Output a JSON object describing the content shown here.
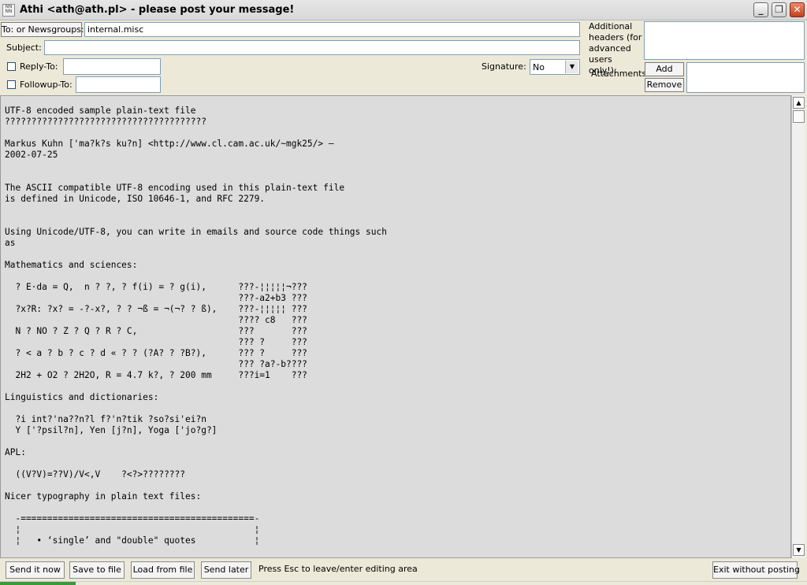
{
  "window": {
    "title": "Athi <ath@ath.pl> - please post your message!",
    "icon": "app-icon",
    "controls": [
      "minimize-icon",
      "restore-icon",
      "close-icon"
    ]
  },
  "header": {
    "to_button": "To: or Newsgroups:",
    "to_value": "internal.misc",
    "subject_label": "Subject:",
    "subject_value": "",
    "reply_to_label": "Reply-To:",
    "reply_to_value": "",
    "followup_to_label": "Followup-To:",
    "followup_to_value": "",
    "signature_label": "Signature:",
    "signature_value": "No",
    "additional_headers_label": "Additional headers (for advanced users only!):",
    "additional_headers_value": "",
    "attachments_label": "Attachments:",
    "add_button": "Add",
    "remove_button": "Remove"
  },
  "body": {
    "text": "UTF-8 encoded sample plain-text file\n??????????????????????????????????????\n\nMarkus Kuhn ['ma?k?s ku?n] <http://www.cl.cam.ac.uk/~mgk25/> —\n2002-07-25\n\n\nThe ASCII compatible UTF-8 encoding used in this plain-text file\nis defined in Unicode, ISO 10646-1, and RFC 2279.\n\n\nUsing Unicode/UTF-8, you can write in emails and source code things such\nas\n\nMathematics and sciences:\n\n  ? E·da = Q,  n ? ?, ? f(i) = ? g(i),      ???-¦¦¦¦¦¬???\n                                            ???-a2+b3 ???\n  ?x?R: ?x? = -?-x?, ? ? ¬ß = ¬(¬? ? ß),    ???-¦¦¦¦¦ ???\n                                            ???? c8   ???\n  N ? NO ? Z ? Q ? R ? C,                   ???       ???\n                                            ??? ?     ???\n  ? < a ? b ? c ? d « ? ? (?A? ? ?B?),      ??? ?     ???\n                                            ??? ?a?-b????\n  2H2 + O2 ? 2H2O, R = 4.7 k?, ? 200 mm     ???i=1    ???\n\nLinguistics and dictionaries:\n\n  ?i int?'na??n?l f?'n?tik ?so?si'ei?n\n  Y ['?psil?n], Yen [j?n], Yoga ['jo?g?]\n\nAPL:\n\n  ((V?V)=??V)/V<,V    ?<?>????????\n\nNicer typography in plain text files:\n\n  -============================================-\n  ¦                                            ¦\n  ¦   • ‘single’ and \"double\" quotes           ¦"
  },
  "footer": {
    "send_now": "Send it now",
    "save_to_file": "Save to file",
    "load_from_file": "Load from file",
    "send_later": "Send later",
    "status": "Press Esc to leave/enter editing area",
    "exit": "Exit without posting"
  }
}
